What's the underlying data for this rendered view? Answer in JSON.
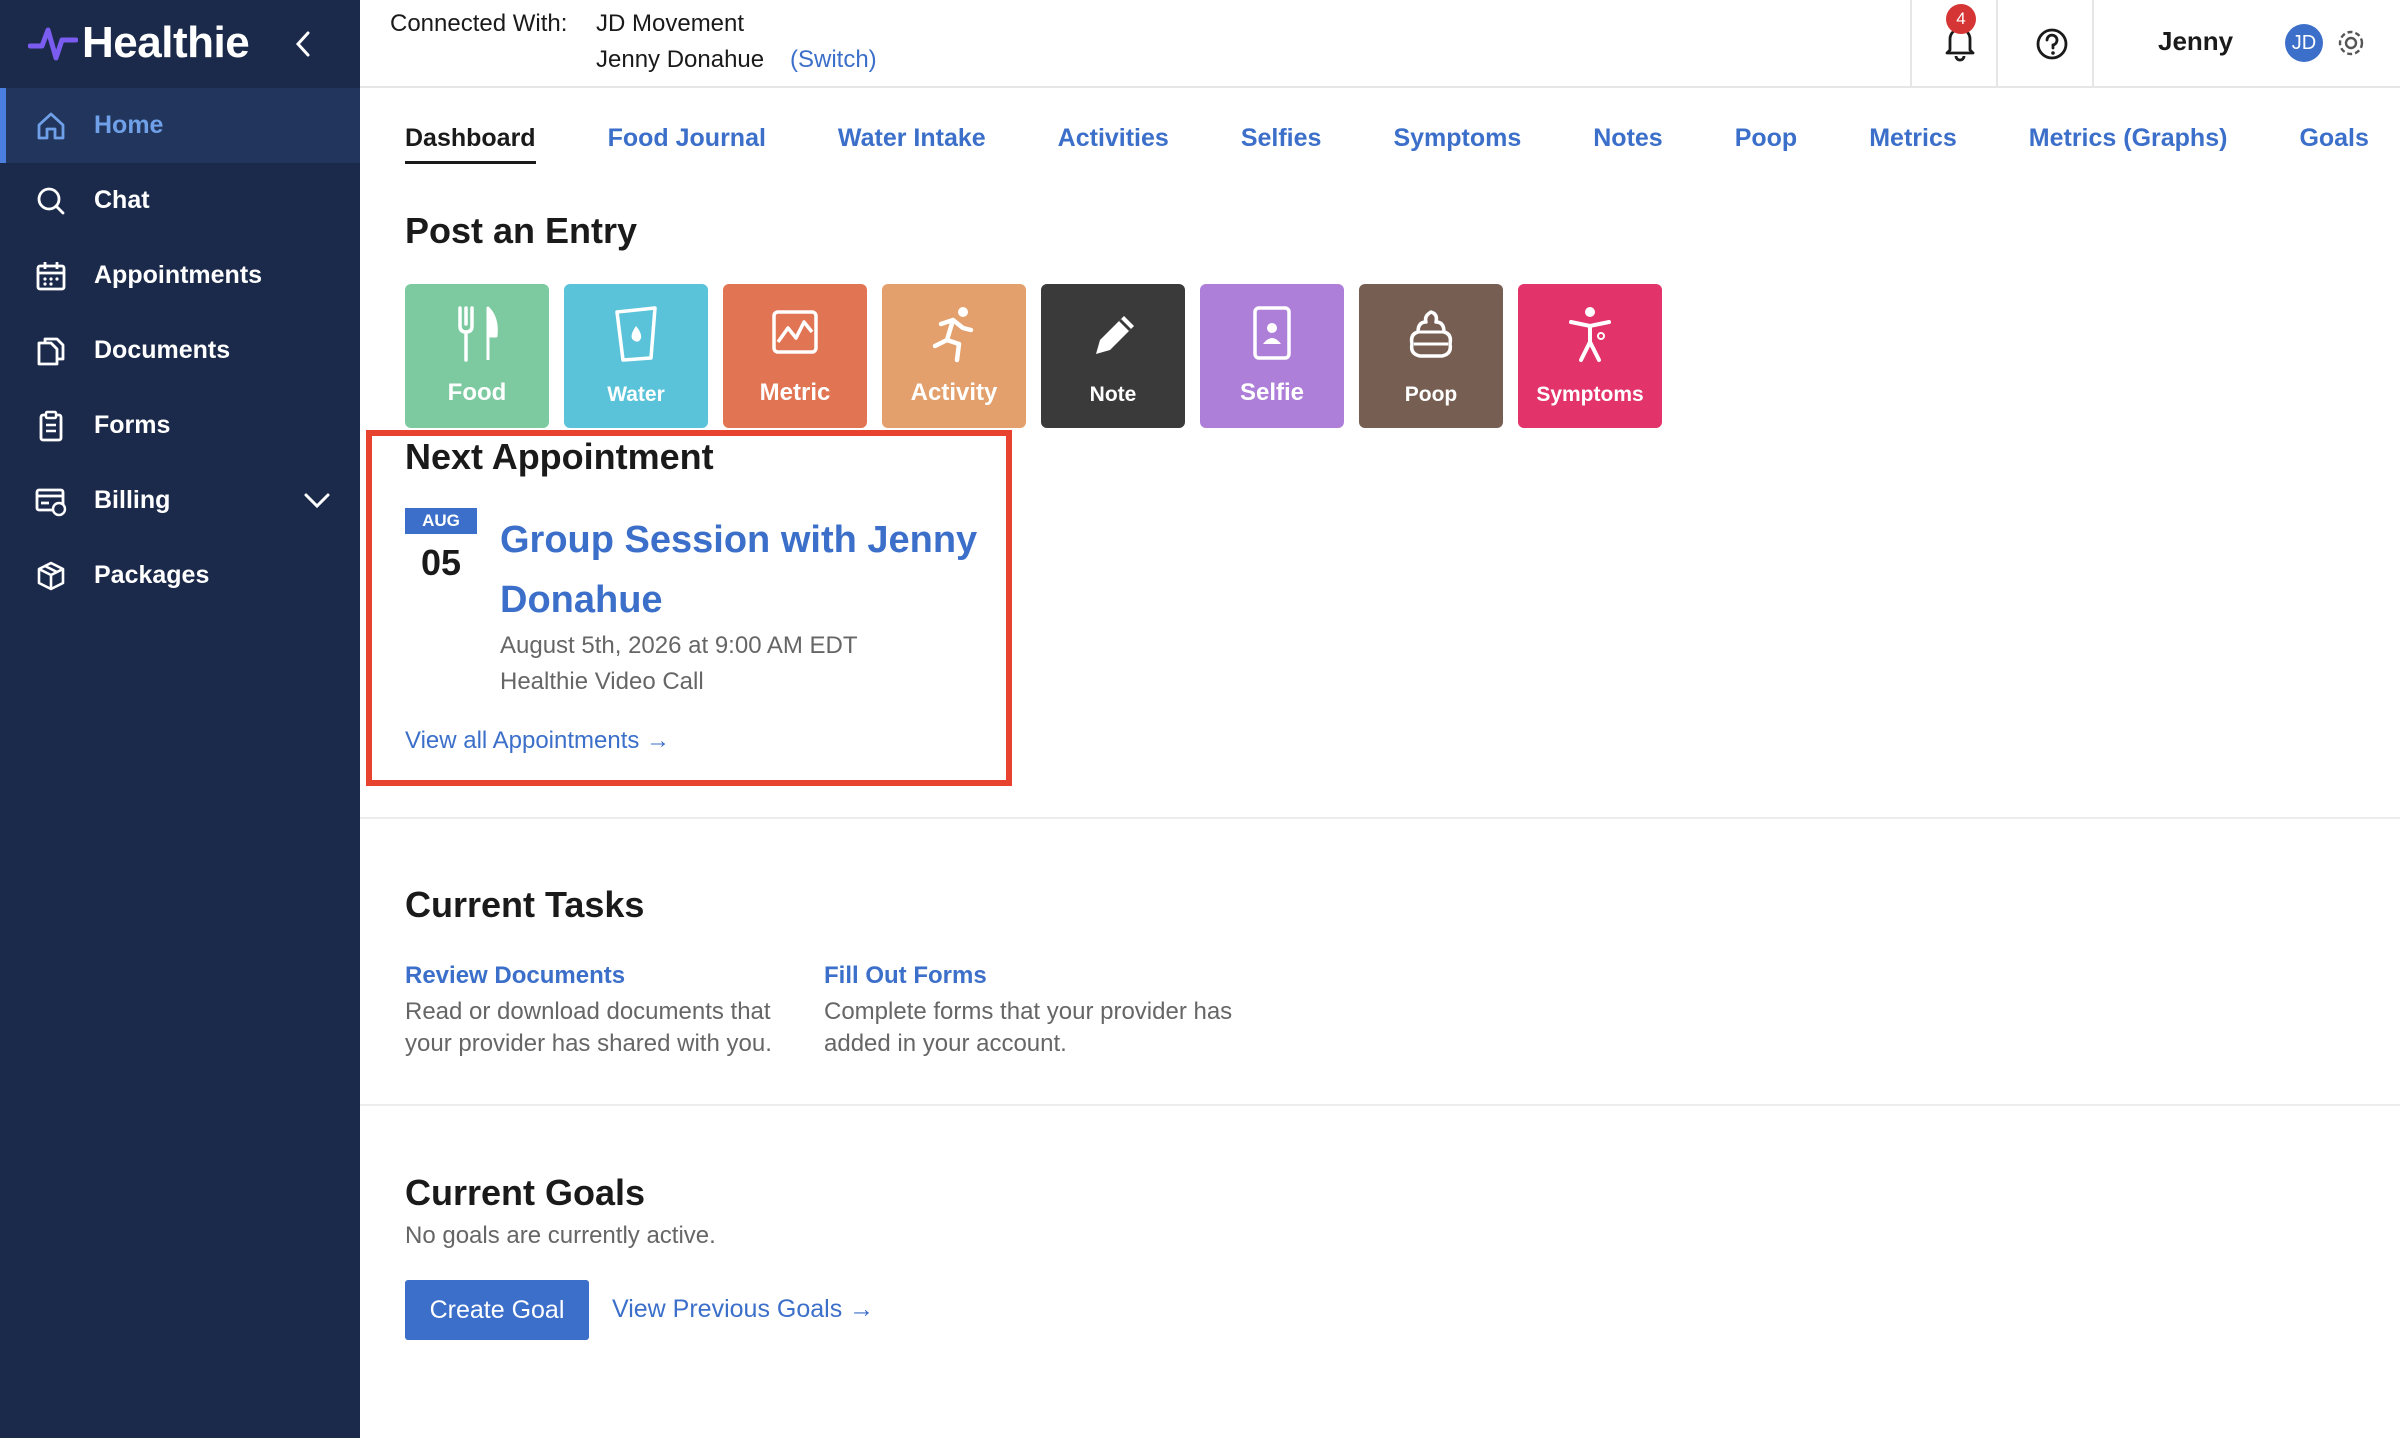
{
  "app": {
    "name": "Healthie",
    "brand_color": "#1b2a4a",
    "accent_color": "#3b6fc9"
  },
  "sidebar": {
    "items": [
      {
        "label": "Home",
        "icon": "home-icon",
        "active": true
      },
      {
        "label": "Chat",
        "icon": "chat-icon"
      },
      {
        "label": "Appointments",
        "icon": "calendar-icon"
      },
      {
        "label": "Documents",
        "icon": "documents-icon"
      },
      {
        "label": "Forms",
        "icon": "clipboard-icon"
      },
      {
        "label": "Billing",
        "icon": "billing-icon",
        "has_submenu": true
      },
      {
        "label": "Packages",
        "icon": "package-icon"
      }
    ]
  },
  "topbar": {
    "connected_label": "Connected With:",
    "org_name": "JD Movement",
    "user_name": "Jenny Donahue",
    "switch_label": "(Switch)",
    "notification_count": "4",
    "account_name": "Jenny",
    "avatar_initials": "JD"
  },
  "tabs": [
    {
      "label": "Dashboard",
      "active": true
    },
    {
      "label": "Food Journal"
    },
    {
      "label": "Water Intake"
    },
    {
      "label": "Activities"
    },
    {
      "label": "Selfies"
    },
    {
      "label": "Symptoms"
    },
    {
      "label": "Notes"
    },
    {
      "label": "Poop"
    },
    {
      "label": "Metrics"
    },
    {
      "label": "Metrics (Graphs)"
    },
    {
      "label": "Goals"
    }
  ],
  "post_entry": {
    "title": "Post an Entry",
    "tiles": [
      {
        "label": "Food",
        "color": "#7dcaa1",
        "icon": "fork-knife-icon"
      },
      {
        "label": "Water",
        "color": "#5bc3d9",
        "icon": "water-cup-icon"
      },
      {
        "label": "Metric",
        "color": "#e07453",
        "icon": "metric-chart-icon"
      },
      {
        "label": "Activity",
        "color": "#e3a06c",
        "icon": "running-person-icon"
      },
      {
        "label": "Note",
        "color": "#3a3a3a",
        "icon": "pencil-icon"
      },
      {
        "label": "Selfie",
        "color": "#ae7fd8",
        "icon": "selfie-icon"
      },
      {
        "label": "Poop",
        "color": "#775e52",
        "icon": "poop-icon"
      },
      {
        "label": "Symptoms",
        "color": "#e2336b",
        "icon": "symptoms-icon"
      }
    ]
  },
  "next_appointment": {
    "title": "Next Appointment",
    "month": "AUG",
    "day": "05",
    "name": "Group Session with Jenny Donahue",
    "datetime": "August 5th, 2026 at 9:00 AM EDT",
    "location": "Healthie Video Call",
    "view_all": "View all Appointments →"
  },
  "current_tasks": {
    "title": "Current Tasks",
    "tasks": [
      {
        "label": "Review Documents",
        "description": "Read or download documents that your provider has shared with you."
      },
      {
        "label": "Fill Out Forms",
        "description": "Complete forms that your provider has added in your account."
      }
    ]
  },
  "current_goals": {
    "title": "Current Goals",
    "empty_message": "No goals are currently active.",
    "create_label": "Create Goal",
    "previous_label": "View Previous Goals →"
  }
}
